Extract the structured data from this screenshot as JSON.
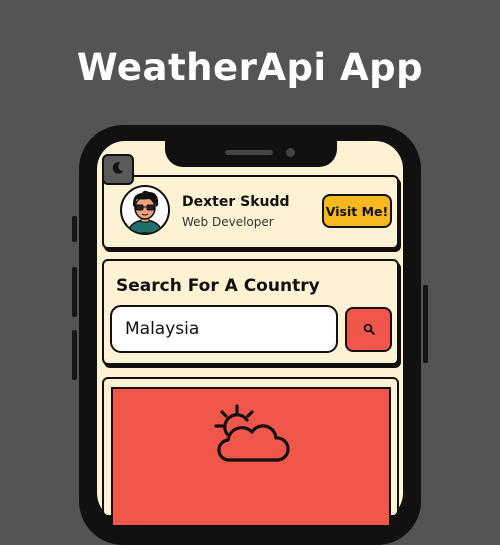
{
  "page": {
    "title": "WeatherApi App"
  },
  "theme_toggle": {
    "icon": "moon-icon"
  },
  "profile": {
    "name": "Dexter Skudd",
    "role": "Web Developer",
    "visit_label": "Visit Me!"
  },
  "search": {
    "title": "Search For A Country",
    "value": "Malaysia",
    "button_icon": "search-icon"
  },
  "weather": {
    "icon": "partly-cloudy-icon"
  },
  "colors": {
    "background": "#545454",
    "screen": "#fdf3d4",
    "accent_red": "#f0574a",
    "accent_yellow": "#f6b81f"
  }
}
